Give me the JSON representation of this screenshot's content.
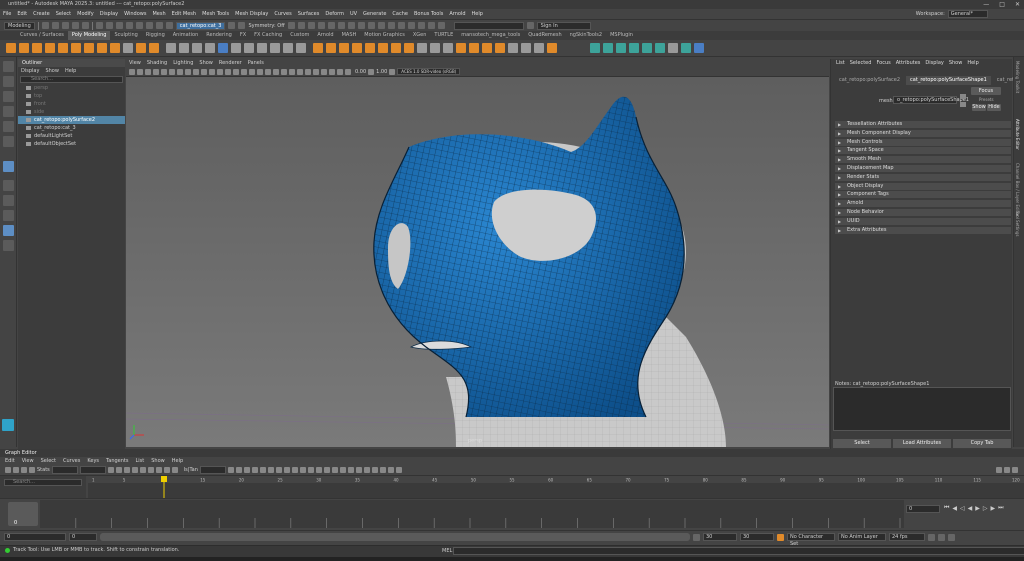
{
  "window": {
    "title": "untitled* - Autodesk MAYA 2025.3: untitled   ---   cat_retopo:polySurface2"
  },
  "menubar": [
    "File",
    "Edit",
    "Create",
    "Select",
    "Modify",
    "Display",
    "Windows",
    "Mesh",
    "Edit Mesh",
    "Mesh Tools",
    "Mesh Display",
    "Curves",
    "Surfaces",
    "Deform",
    "UV",
    "Generate",
    "Cache",
    "Bonus Tools",
    "Arnold",
    "Help"
  ],
  "workspace": {
    "label": "Workspace:",
    "value": "General*"
  },
  "statusline": {
    "mode": "Modeling",
    "sel_field": "cat_retopo:cat_3",
    "symmetry": "Symmetry: Off",
    "signin": "Sign In"
  },
  "shelftabs": [
    "Curves / Surfaces",
    "Poly Modeling",
    "Sculpting",
    "Rigging",
    "Animation",
    "Rendering",
    "FX",
    "FX Caching",
    "Custom",
    "Arnold",
    "MASH",
    "Motion Graphics",
    "XGen",
    "TURTLE",
    "mansotech_mega_tools",
    "QuadRemesh",
    "ngSkinTools2",
    "MSPlugin"
  ],
  "shelftab_active": "Poly Modeling",
  "outliner": {
    "title": "Outliner",
    "menu": [
      "Display",
      "Show",
      "Help"
    ],
    "search_placeholder": "Search...",
    "items": [
      {
        "label": "persp",
        "state": "dim"
      },
      {
        "label": "top",
        "state": "dim"
      },
      {
        "label": "front",
        "state": "dim"
      },
      {
        "label": "side",
        "state": "dim"
      },
      {
        "label": "cat_retopo:polySurface2",
        "state": "sel"
      },
      {
        "label": "cat_retopo:cat_3",
        "state": "normal"
      },
      {
        "label": "defaultLightSet",
        "state": "normal"
      },
      {
        "label": "defaultObjectSet",
        "state": "normal"
      }
    ]
  },
  "viewport": {
    "menu": [
      "View",
      "Shading",
      "Lighting",
      "Show",
      "Renderer",
      "Panels"
    ],
    "near_value": "0.00",
    "far_value": "1.00",
    "colorspace": "ACES 1.0 SDR-video (sRGB)",
    "camera_label": "persp"
  },
  "attribute_editor": {
    "menu": [
      "List",
      "Selected",
      "Focus",
      "Attributes",
      "Display",
      "Show",
      "Help"
    ],
    "tabs": [
      "cat_retopo:polySurface2",
      "cat_retopo:polySurfaceShape1",
      "cat_retopo:cat_3"
    ],
    "active_tab": "cat_retopo:polySurfaceShape1",
    "mesh_label": "mesh:",
    "mesh_value": "o_retopo:polySurfaceShape1",
    "focus_btn": "Focus",
    "presets_label": "Presets",
    "show_btn": "Show",
    "hide_btn": "Hide",
    "sections": [
      "Tessellation Attributes",
      "Mesh Component Display",
      "Mesh Controls",
      "Tangent Space",
      "Smooth Mesh",
      "Displacement Map",
      "Render Stats",
      "Object Display",
      "Component Tags",
      "Arnold",
      "Node Behavior",
      "UUID",
      "Extra Attributes"
    ],
    "notes_label": "Notes: cat_retopo:polySurfaceShape1",
    "buttons": [
      "Select",
      "Load Attributes",
      "Copy Tab"
    ]
  },
  "right_strip_tabs": [
    "Modeling Toolkit",
    "Attribute Editor",
    "Channel Box / Layer Editor",
    "Tool Settings"
  ],
  "graph_editor": {
    "title": "Graph Editor",
    "menu": [
      "Edit",
      "View",
      "Select",
      "Curves",
      "Keys",
      "Tangents",
      "List",
      "Show",
      "Help"
    ],
    "stats_label": "Stats",
    "search_placeholder": "Search...",
    "tooltip_prefix": "ls|Tan",
    "ruler": [
      "1",
      "5",
      "10",
      "15",
      "20",
      "25",
      "30",
      "35",
      "40",
      "45",
      "50",
      "55",
      "60",
      "65",
      "70",
      "75",
      "80",
      "85",
      "90",
      "95",
      "100",
      "105",
      "110",
      "115",
      "120"
    ]
  },
  "timeslider": {
    "current_frame": "0",
    "ticks": [
      "5",
      "10",
      "15",
      "20",
      "25",
      "30",
      "35",
      "40",
      "45",
      "50",
      "55",
      "60",
      "65",
      "70",
      "75",
      "80",
      "85",
      "90",
      "95",
      "100",
      "105",
      "110",
      "115",
      "120"
    ],
    "frame_field": "0",
    "time_field": "0"
  },
  "rangeslider": {
    "start": "0",
    "start2": "0",
    "end_a": "30",
    "end_b": "30",
    "character_set": "No Character Set",
    "anim_layer": "No Anim Layer",
    "fps": "24 fps"
  },
  "commandline": {
    "help_text": "Track Tool: Use LMB or MMB to track. Shift to constrain translation.",
    "mel_label": "MEL"
  },
  "colors": {
    "mesh_blue": "#1a6fb5",
    "wire_dark": "#0c2f50",
    "select_highlight": "#5285a6",
    "shelf_orange": "#e08a2a",
    "shelf_teal": "#3da39a",
    "timeslider_key": "#f0d000"
  }
}
